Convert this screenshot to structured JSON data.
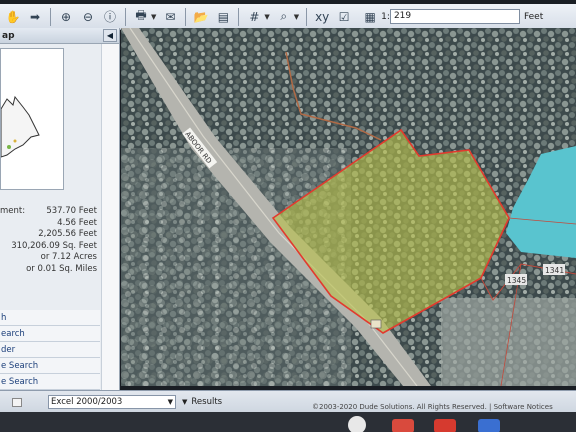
{
  "toolbar": {
    "scale_prefix": "1:",
    "scale_value": "219",
    "scale_unit": "Feet",
    "icons": [
      "pan-icon",
      "forward-icon",
      "zoom-in-icon",
      "zoom-out-icon",
      "info-icon",
      "print-icon",
      "email-icon",
      "folder-icon",
      "layers-icon",
      "grid-icon",
      "zoom-select-icon",
      "xy-icon",
      "checkbox-icon",
      "measure-icon"
    ]
  },
  "left_panel": {
    "title": "ap",
    "measurements": [
      {
        "label": "ment:",
        "value": "537.70 Feet"
      },
      {
        "label": "",
        "value": "4.56 Feet"
      },
      {
        "label": "",
        "value": "2,205.56 Feet"
      },
      {
        "label": "",
        "value": "310,206.09 Sq. Feet"
      },
      {
        "label": "",
        "value": "or 7.12 Acres"
      },
      {
        "label": "",
        "value": "or 0.01 Sq. Miles"
      }
    ],
    "tools": [
      {
        "label": "h"
      },
      {
        "label": "earch"
      },
      {
        "label": "der"
      },
      {
        "label": "e Search"
      },
      {
        "label": "e Search"
      }
    ]
  },
  "map": {
    "road_label": "ABOOR RD",
    "parcel_labels": [
      "1345",
      "1341"
    ],
    "parcel_color": "#e23a2e",
    "selection_fill": "#b9c24a",
    "water_color": "#59c4cf"
  },
  "bottom": {
    "export_format": "Excel 2000/2003",
    "results_label": "Results",
    "copyright": "©2003-2020 Dude Solutions. All Rights Reserved. | Software Notices"
  }
}
